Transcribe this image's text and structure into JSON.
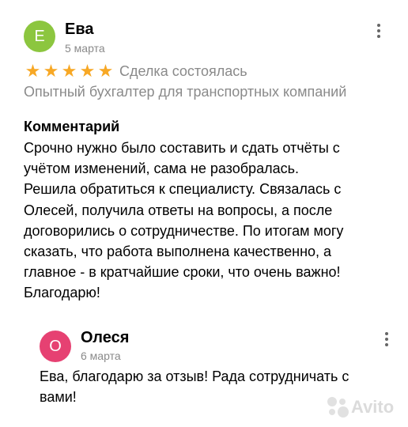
{
  "review": {
    "author_initial": "Е",
    "author_name": "Ева",
    "date": "5 марта",
    "avatar_color": "#8cc63f",
    "rating": 5,
    "stars": [
      "★",
      "★",
      "★",
      "★",
      "★"
    ],
    "deal_status": "Сделка состоялась",
    "service": "Опытный бухгалтер для транспортных компаний",
    "comment_title": "Комментарий",
    "comment_lines": [
      "Срочно нужно было составить и сдать отчёты с",
      "учётом изменений, сама не разобралась.",
      "Решила обратиться к специалисту. Связалась с",
      "Олесей, получила ответы на вопросы, а после",
      "договорились о сотрудничестве. По итогам могу",
      "сказать, что работа выполнена качественно, а",
      "главное - в кратчайшие сроки, что очень важно!",
      "Благодарю!"
    ]
  },
  "reply": {
    "author_initial": "О",
    "author_name": "Олеся",
    "date": "6 марта",
    "text_lines": [
      "Ева, благодарю за отзыв! Рада сотрудничать с",
      "вами!"
    ]
  },
  "watermark": {
    "text": "Avito"
  },
  "colors": {
    "star": "#f7a825",
    "muted": "#8a8a8a",
    "reply_avatar": "#e64172"
  }
}
